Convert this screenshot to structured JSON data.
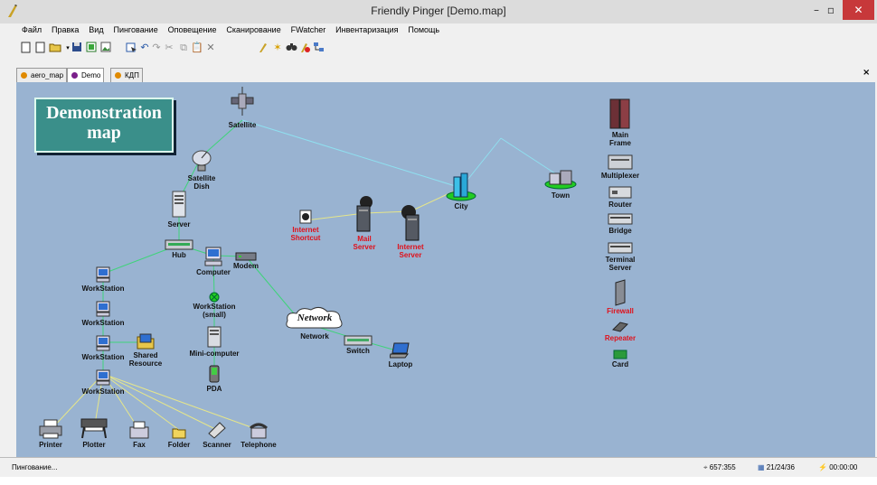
{
  "window": {
    "title": "Friendly Pinger [Demo.map]",
    "min": "–",
    "max": "▫",
    "close": "✕"
  },
  "menu": [
    "Файл",
    "Правка",
    "Вид",
    "Пингование",
    "Оповещение",
    "Сканирование",
    "FWatcher",
    "Инвентаризация",
    "Помощь"
  ],
  "tabs": [
    {
      "label": "aero_map",
      "dot_color": "#e08a00"
    },
    {
      "label": "Demo",
      "dot_color": "#7a1f8a"
    },
    {
      "label": "КДП",
      "dot_color": "#e08a00"
    }
  ],
  "tab_close": "×",
  "map": {
    "title_line1": "Demonstration",
    "title_line2": "map",
    "nodes": {
      "satellite": "Satellite",
      "satellite_dish_1": "Satellite",
      "satellite_dish_2": "Dish",
      "server": "Server",
      "hub": "Hub",
      "computer": "Computer",
      "modem": "Modem",
      "workstation_small_1": "WorkStation",
      "workstation_small_2": "(small)",
      "minicomputer": "Mini-computer",
      "pda": "PDA",
      "ws1": "WorkStation",
      "ws2": "WorkStation",
      "ws3": "WorkStation",
      "ws4": "WorkStation",
      "shared_1": "Shared",
      "shared_2": "Resource",
      "printer": "Printer",
      "plotter": "Plotter",
      "fax": "Fax",
      "folder": "Folder",
      "scanner": "Scanner",
      "telephone": "Telephone",
      "internet_shortcut_1": "Internet",
      "internet_shortcut_2": "Shortcut",
      "mail_server_1": "Mail",
      "mail_server_2": "Server",
      "internet_server_1": "Internet",
      "internet_server_2": "Server",
      "city": "City",
      "town": "Town",
      "network_cloud": "Network",
      "network": "Network",
      "switch": "Switch",
      "laptop": "Laptop",
      "main_frame_1": "Main",
      "main_frame_2": "Frame",
      "multiplexer": "Multiplexer",
      "router": "Router",
      "bridge": "Bridge",
      "terminal_server_1": "Terminal",
      "terminal_server_2": "Server",
      "firewall": "Firewall",
      "repeater": "Repeater",
      "card": "Card"
    }
  },
  "status": {
    "left": "Пингование...",
    "coords": "657:355",
    "counts": "21/24/36",
    "time": "00:00:00"
  },
  "colors": {
    "map_bg": "#99b3d1",
    "link_green": "#3fd37a",
    "link_cyan": "#8fe0f0",
    "link_yellow": "#e6e68a",
    "title_box": "#3a8f8a",
    "alert_red": "#e0101a"
  }
}
